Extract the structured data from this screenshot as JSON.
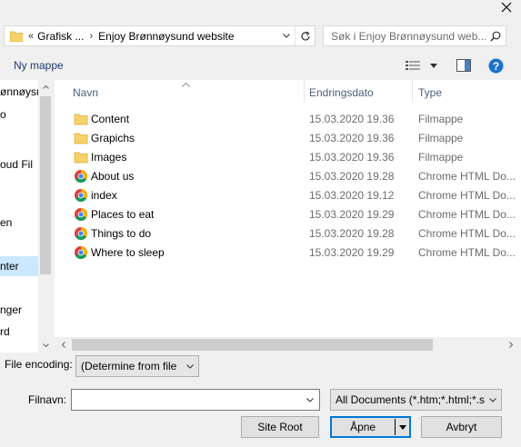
{
  "window": {
    "close_glyph": "✕"
  },
  "address": {
    "overflow": "«",
    "crumbs": [
      "Grafisk ...",
      "Enjoy Brønnøysund website"
    ],
    "chevron": "›"
  },
  "search": {
    "placeholder": "Søk i Enjoy Brønnøysund web..."
  },
  "toolbar": {
    "new_folder": "Ny mappe"
  },
  "nav": {
    "items": [
      "ønnøysu",
      "o",
      "oud Fil",
      "en",
      "nter",
      "nger",
      "rd"
    ]
  },
  "columns": {
    "name": "Navn",
    "date": "Endringsdato",
    "type": "Type"
  },
  "files": [
    {
      "name": "Content",
      "date": "15.03.2020 19.36",
      "type": "Filmappe",
      "icon": "folder-icon"
    },
    {
      "name": "Grapichs",
      "date": "15.03.2020 19.36",
      "type": "Filmappe",
      "icon": "folder-icon"
    },
    {
      "name": "Images",
      "date": "15.03.2020 19.36",
      "type": "Filmappe",
      "icon": "folder-icon"
    },
    {
      "name": "About us",
      "date": "15.03.2020 19.28",
      "type": "Chrome HTML Do...",
      "icon": "chrome-icon"
    },
    {
      "name": "index",
      "date": "15.03.2020 19.12",
      "type": "Chrome HTML Do...",
      "icon": "chrome-icon"
    },
    {
      "name": "Places to eat",
      "date": "15.03.2020 19.29",
      "type": "Chrome HTML Do...",
      "icon": "chrome-icon"
    },
    {
      "name": "Things to do",
      "date": "15.03.2020 19.28",
      "type": "Chrome HTML Do...",
      "icon": "chrome-icon"
    },
    {
      "name": "Where to sleep",
      "date": "15.03.2020 19.29",
      "type": "Chrome HTML Do...",
      "icon": "chrome-icon"
    }
  ],
  "bottom": {
    "encoding_label": "File encoding:",
    "encoding_value": "(Determine from file",
    "filename_label": "Filnavn:",
    "filename_value": "",
    "filter_value": "All Documents (*.htm;*.html;*.s",
    "site_root": "Site Root",
    "open": "Åpne",
    "cancel": "Avbryt"
  },
  "colors": {
    "folder": "#f5d36a",
    "accent": "#0078d7",
    "help": "#1a73c8"
  }
}
